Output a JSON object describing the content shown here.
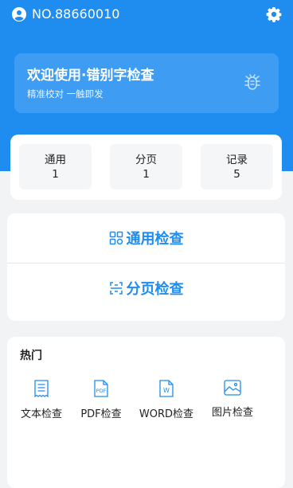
{
  "header": {
    "account_no": "NO.88660010"
  },
  "banner": {
    "title": "欢迎使用·错别字检查",
    "subtitle": "精准校对 一触即发"
  },
  "stats": [
    {
      "label": "通用",
      "value": "1"
    },
    {
      "label": "分页",
      "value": "1"
    },
    {
      "label": "记录",
      "value": "5"
    }
  ],
  "checks": {
    "general": "通用检查",
    "paged": "分页检查"
  },
  "hot": {
    "title": "热门",
    "tools": [
      {
        "label": "文本检查",
        "icon": "text-doc-icon"
      },
      {
        "label": "PDF检查",
        "icon": "pdf-icon"
      },
      {
        "label": "WORD检查",
        "icon": "word-icon"
      },
      {
        "label": "图片检查",
        "icon": "image-icon"
      }
    ]
  },
  "colors": {
    "brand": "#1f8cf0",
    "background": "#f2f3f5"
  }
}
